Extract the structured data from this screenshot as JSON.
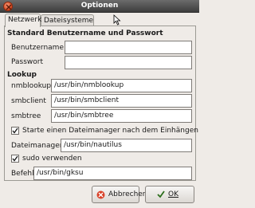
{
  "window": {
    "title": "Optionen"
  },
  "tabs": [
    {
      "label": "Netzwerk"
    },
    {
      "label": "Dateisysteme"
    }
  ],
  "section_standard": {
    "heading": "Standard Benutzername und Passwort",
    "username_label": "Benutzername",
    "username_value": "",
    "password_label": "Passwort",
    "password_value": ""
  },
  "section_lookup": {
    "heading": "Lookup",
    "nmblookup_label": "nmblookup",
    "nmblookup_value": "/usr/bin/nmblookup",
    "smbclient_label": "smbclient",
    "smbclient_value": "/usr/bin/smbclient",
    "smbtree_label": "smbtree",
    "smbtree_value": "/usr/bin/smbtree"
  },
  "filemanager": {
    "checkbox_label": "Starte einen Dateimanager nach dem Einhängen",
    "checked": true,
    "label": "Dateimanager",
    "value": "/usr/bin/nautilus"
  },
  "sudo": {
    "checkbox_label": "sudo verwenden",
    "checked": true,
    "command_label": "Befehl",
    "command_value": "/usr/bin/gksu"
  },
  "buttons": {
    "cancel": "Abbrechen",
    "ok": "OK"
  },
  "icons": {
    "close": "close-icon",
    "cancel": "cancel-icon",
    "ok": "ok-icon",
    "checkmark": "checkmark-icon",
    "cursor": "mouse-cursor-icon"
  }
}
